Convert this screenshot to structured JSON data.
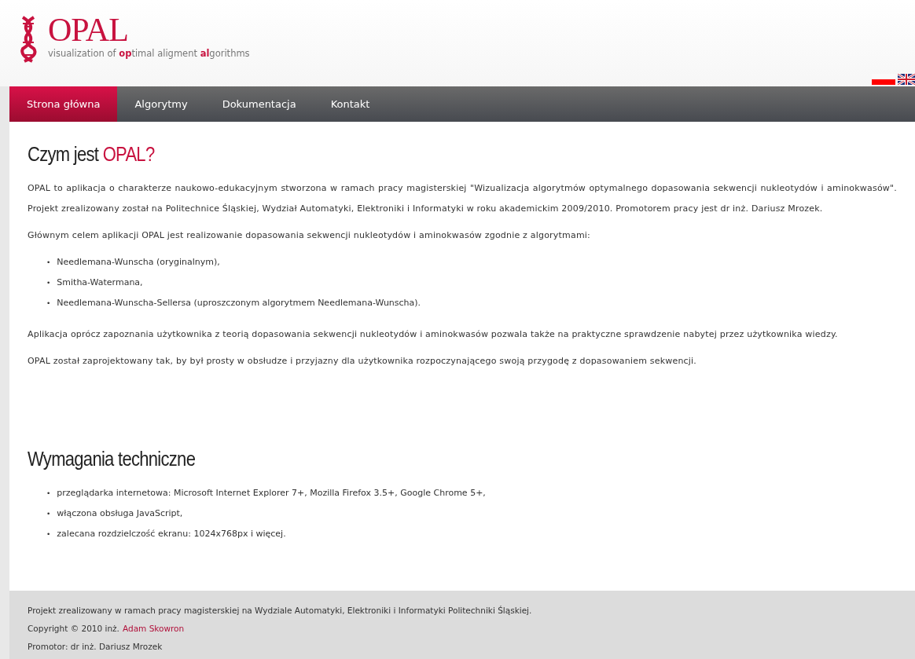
{
  "header": {
    "logo_title": "OPAL",
    "tagline": "visualization of **op**timal aligment **al**gorithms"
  },
  "languages": [
    {
      "kind": "pl"
    },
    {
      "kind": "en"
    }
  ],
  "nav": [
    {
      "label": "Strona główna",
      "selected": true
    },
    {
      "label": "Algorytmy",
      "selected": false
    },
    {
      "label": "Dokumentacja",
      "selected": false
    },
    {
      "label": "Kontakt",
      "selected": false
    }
  ],
  "sections": [
    {
      "heading": "Czym jest *OPAL?*",
      "blocks": [
        {
          "kind": "paragraph",
          "text": "OPAL to aplikacja o charakterze naukowo-edukacyjnym stworzona w ramach pracy magisterskiej \"Wizualizacja algorytmów optymalnego dopasowania sekwencji nukleotydów i aminokwasów\". Projekt zrealizowany został na Politechnice Śląskiej, Wydział Automatyki, Elektroniki i Informatyki w roku akademickim 2009/2010. Promotorem pracy jest dr inż. Dariusz Mrozek."
        },
        {
          "kind": "paragraph",
          "text": "Głównym celem aplikacji OPAL jest realizowanie dopasowania sekwencji nukleotydów i aminokwasów zgodnie z algorytmami:"
        },
        {
          "kind": "list",
          "marker": "•",
          "items": [
            "Needlemana-Wunscha (oryginalnym),",
            "Smitha-Watermana,",
            "Needlemana-Wunscha-Sellersa (uproszczonym algorytmem Needlemana-Wunscha)."
          ]
        },
        {
          "kind": "paragraph",
          "text": "Aplikacja oprócz zapoznania użytkownika z teorią dopasowania sekwencji nukleotydów i aminokwasów pozwala także na praktyczne sprawdzenie nabytej przez użytkownika wiedzy."
        },
        {
          "kind": "paragraph",
          "text": "OPAL został zaprojektowany tak, by był prosty w obsłudze i przyjazny dla użytkownika rozpoczynającego swoją przygodę z dopasowaniem sekwencji."
        }
      ]
    },
    {
      "heading": "Wymagania techniczne",
      "blocks": [
        {
          "kind": "list",
          "marker": "•",
          "items": [
            "przeglądarka internetowa: Microsoft Internet Explorer 7+, Mozilla Firefox 3.5+, Google Chrome 5+,",
            "włączona obsługa JavaScript,",
            "zalecana rozdzielczość ekranu: 1024x768px i więcej."
          ]
        }
      ]
    }
  ],
  "footer": {
    "line_1": "Projekt zrealizowany w ramach pracy magisterskiej na Wydziale Automatyki, Elektroniki i Informatyki Politechniki Śląskiej.",
    "copyright_prefix": "Copyright © 2010 inż.",
    "author_link": "Adam Skowron",
    "line_3": "Promotor: dr inż. Dariusz Mrozek"
  }
}
